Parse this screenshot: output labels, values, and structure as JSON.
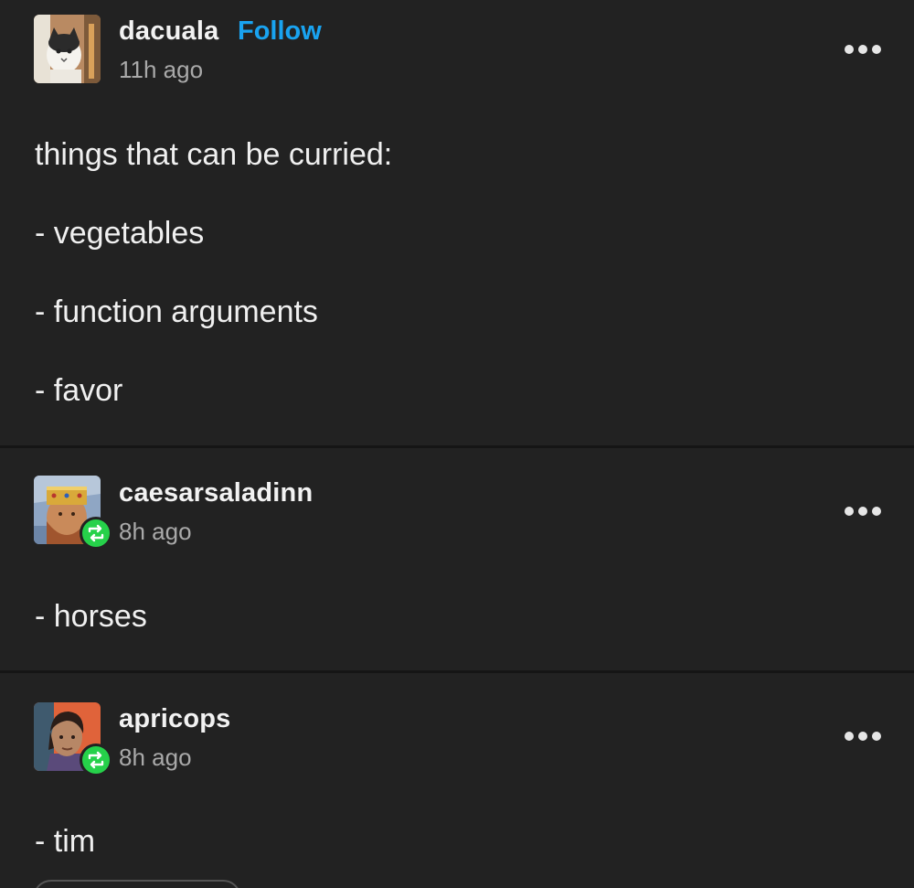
{
  "posts": [
    {
      "username": "dacuala",
      "follow_label": "Follow",
      "time": "11h ago",
      "avatar_icon": "cat-avatar-icon",
      "lines": [
        "things that can be curried:",
        "- vegetables",
        "- function arguments",
        "- favor"
      ]
    },
    {
      "username": "caesarsaladinn",
      "time": "8h ago",
      "avatar_icon": "king-portrait-avatar-icon",
      "reblog_icon": "reblog-icon",
      "lines": [
        "- horses"
      ]
    },
    {
      "username": "apricops",
      "time": "8h ago",
      "avatar_icon": "man-portrait-avatar-icon",
      "reblog_icon": "reblog-icon",
      "lines": [
        "- tim"
      ]
    }
  ],
  "colors": {
    "background": "#222222",
    "follow": "#19a3f0",
    "reblog_badge": "#26d14a",
    "timestamp": "#a9a9a9"
  }
}
